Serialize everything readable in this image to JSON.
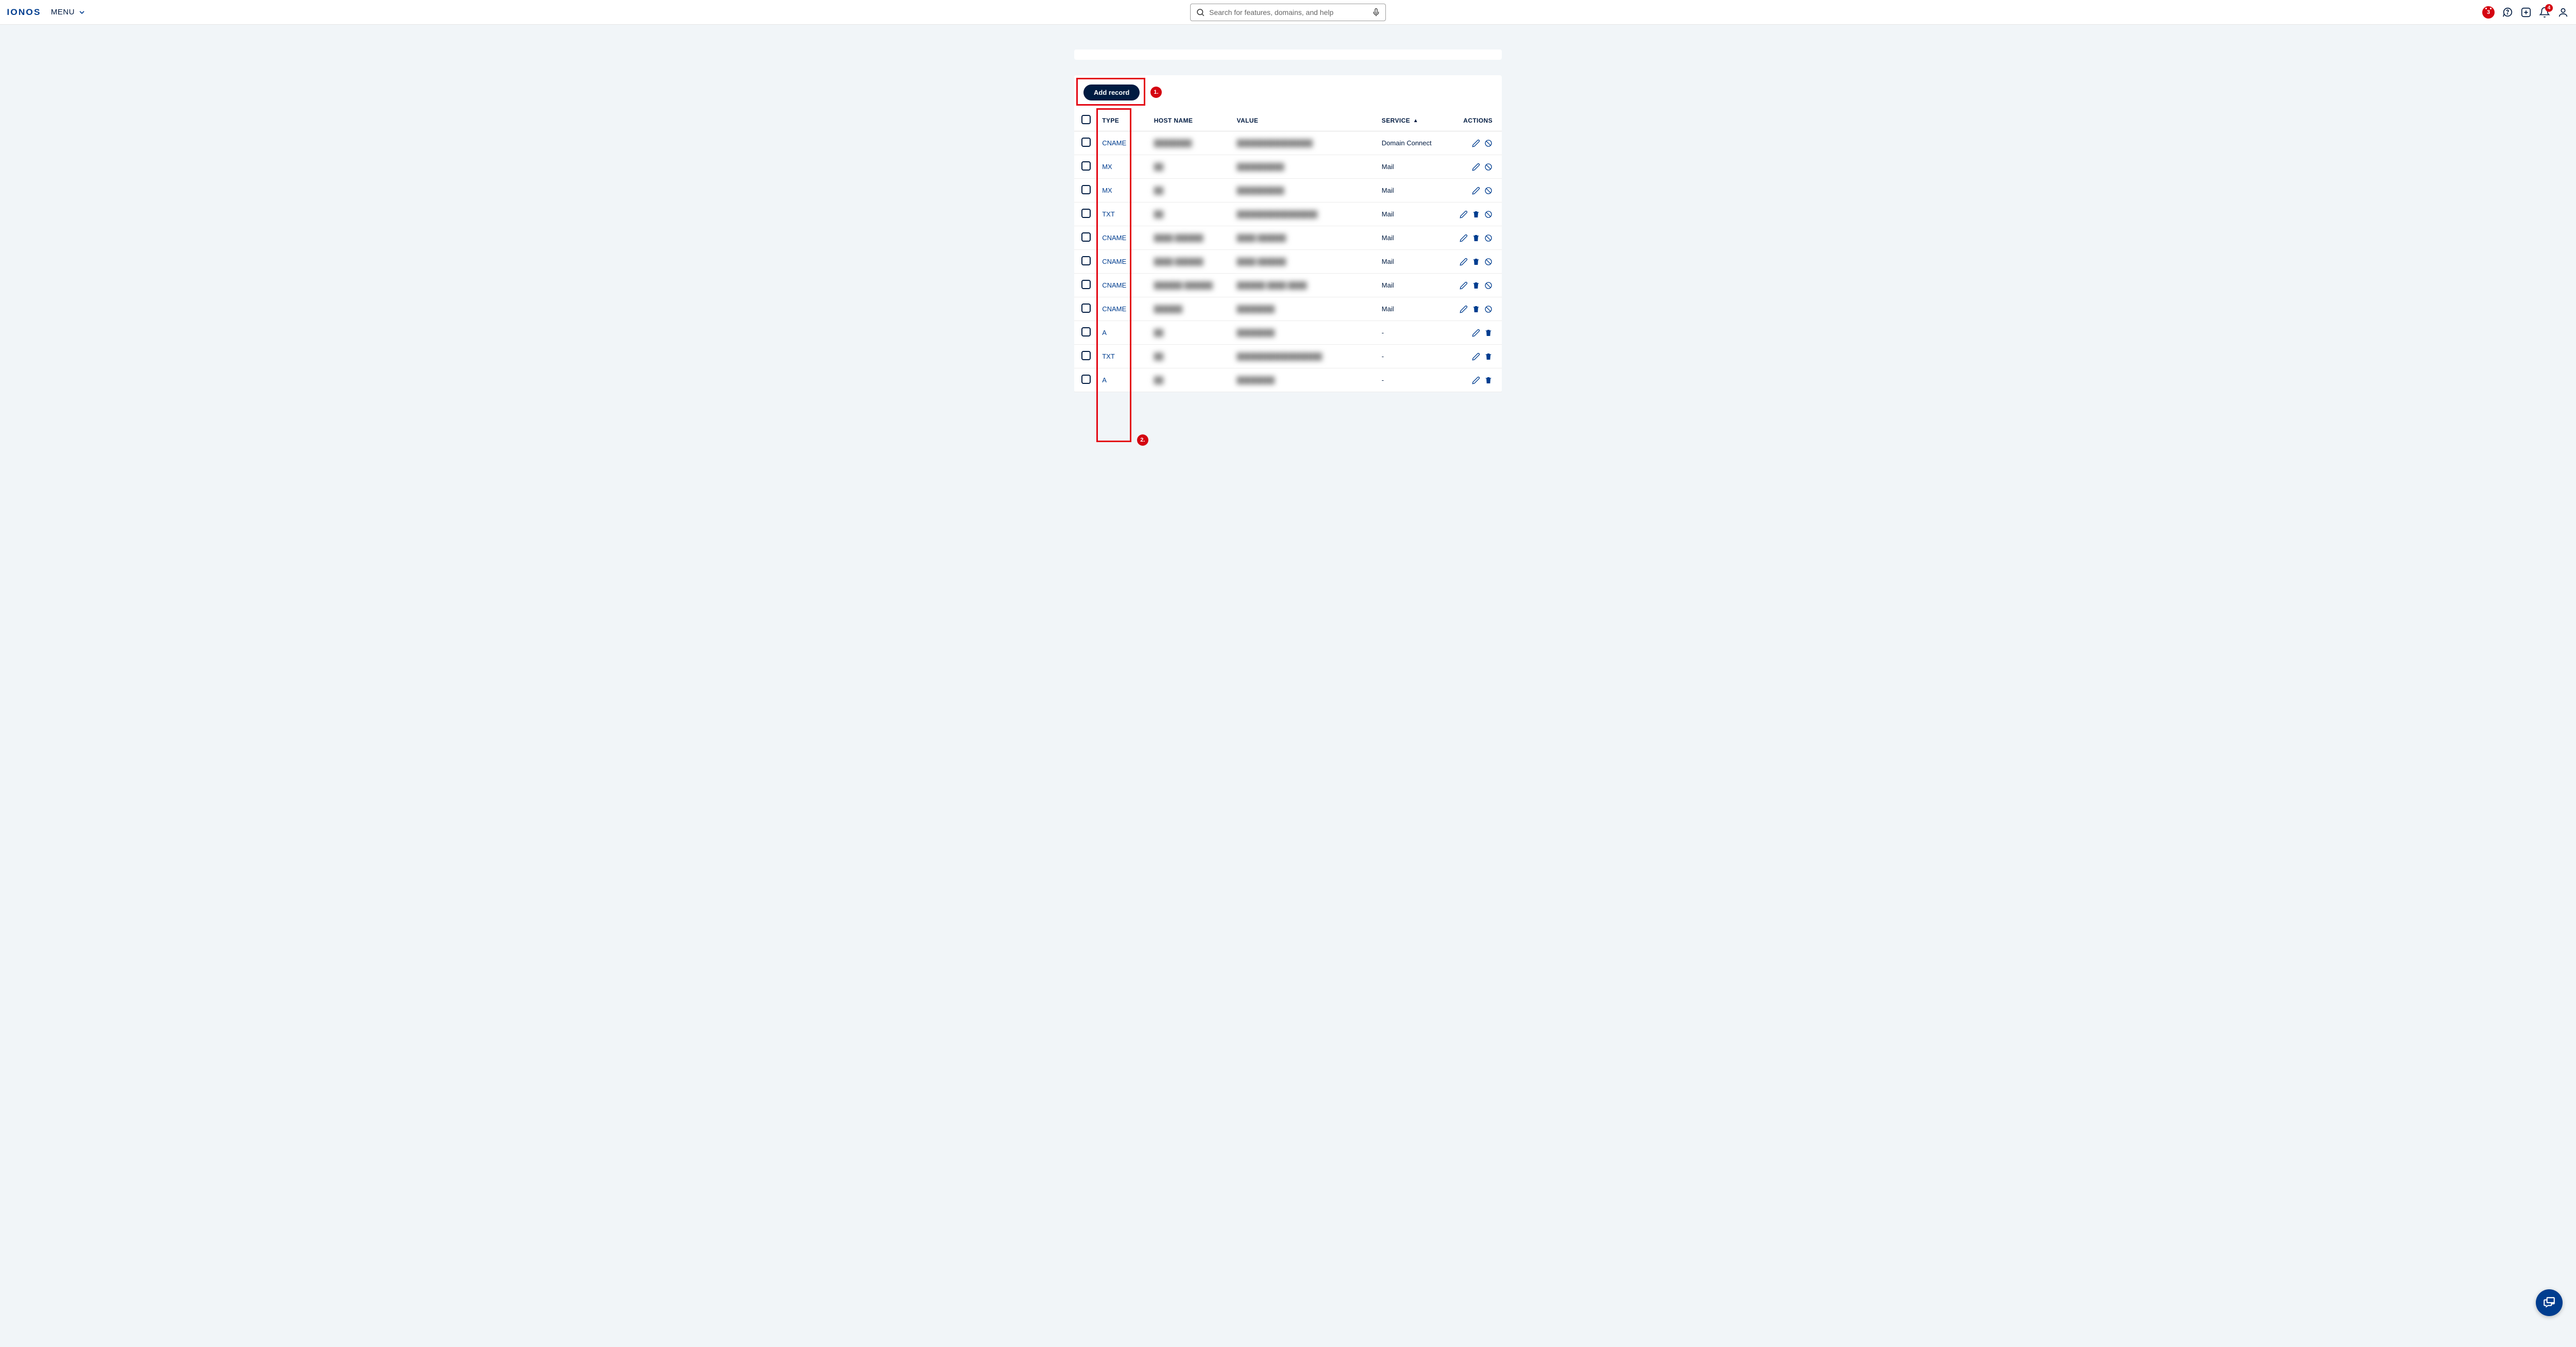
{
  "header": {
    "logo_text": "IONOS",
    "menu_label": "MENU",
    "search_placeholder": "Search for features, domains, and help",
    "cal_badge": "3",
    "bell_badge": "4"
  },
  "annotations": {
    "dot1": "1.",
    "dot2": "2."
  },
  "toolbar": {
    "add_record_label": "Add record"
  },
  "table": {
    "headers": {
      "type": "TYPE",
      "host": "HOST NAME",
      "value": "VALUE",
      "service": "SERVICE",
      "actions": "ACTIONS"
    },
    "rows": [
      {
        "type": "CNAME",
        "host": "████████",
        "value": "████████████████",
        "service": "Domain Connect",
        "actions": [
          "edit",
          "disable"
        ]
      },
      {
        "type": "MX",
        "host": "██",
        "value": "██████████",
        "service": "Mail",
        "actions": [
          "edit",
          "disable"
        ]
      },
      {
        "type": "MX",
        "host": "██",
        "value": "██████████",
        "service": "Mail",
        "actions": [
          "edit",
          "disable"
        ]
      },
      {
        "type": "TXT",
        "host": "██",
        "value": "█████████████████",
        "service": "Mail",
        "actions": [
          "edit",
          "delete",
          "disable"
        ]
      },
      {
        "type": "CNAME",
        "host": "████ ██████",
        "value": "████ ██████",
        "service": "Mail",
        "actions": [
          "edit",
          "delete",
          "disable"
        ]
      },
      {
        "type": "CNAME",
        "host": "████ ██████",
        "value": "████ ██████",
        "service": "Mail",
        "actions": [
          "edit",
          "delete",
          "disable"
        ]
      },
      {
        "type": "CNAME",
        "host": "██████ ██████",
        "value": "██████ ████ ████",
        "service": "Mail",
        "actions": [
          "edit",
          "delete",
          "disable"
        ]
      },
      {
        "type": "CNAME",
        "host": "██████",
        "value": "████████",
        "service": "Mail",
        "actions": [
          "edit",
          "delete",
          "disable"
        ]
      },
      {
        "type": "A",
        "host": "██",
        "value": "████████",
        "service": "-",
        "actions": [
          "edit",
          "delete"
        ]
      },
      {
        "type": "TXT",
        "host": "██",
        "value": "██████████████████",
        "service": "-",
        "actions": [
          "edit",
          "delete"
        ]
      },
      {
        "type": "A",
        "host": "██",
        "value": "████████",
        "service": "-",
        "actions": [
          "edit",
          "delete"
        ]
      }
    ]
  }
}
